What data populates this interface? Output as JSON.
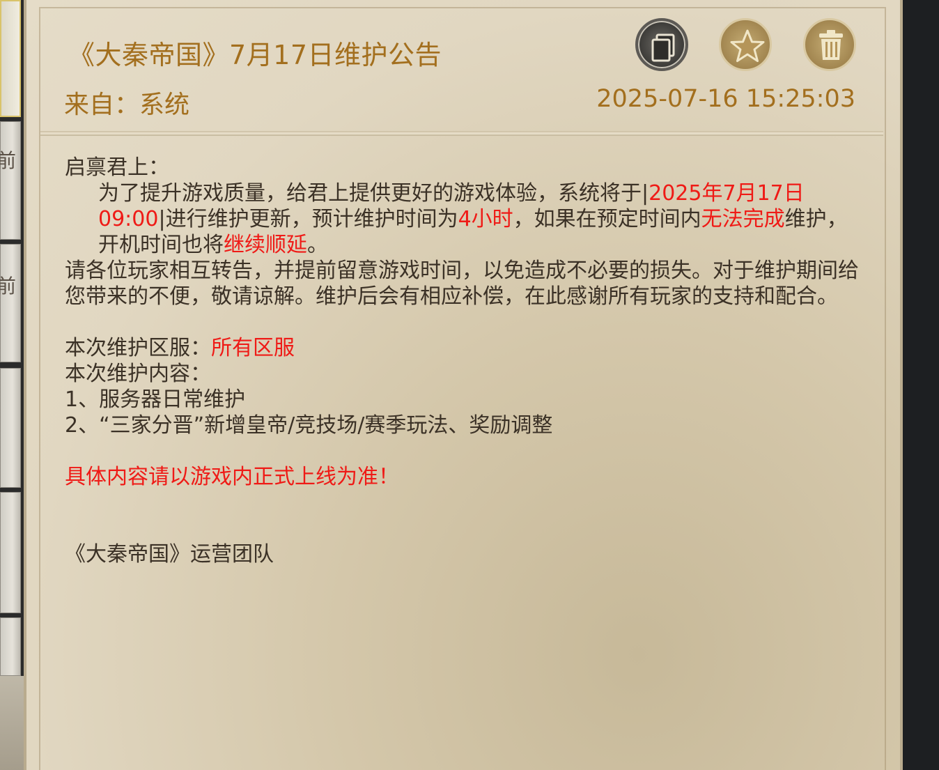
{
  "mail": {
    "title": "《大秦帝国》7月17日维护公告",
    "from": "来自：系统",
    "datetime": "2025-07-16 15:25:03",
    "greeting": "启禀君上：",
    "para1": [
      {
        "text": "为了提升游戏质量，给君上提供更好的游戏体验，系统将于|",
        "red": false
      },
      {
        "text": "2025年7月17日09:00",
        "red": true
      },
      {
        "text": "|进行维护更新，预计维护时间为",
        "red": false
      },
      {
        "text": "4小时",
        "red": true
      },
      {
        "text": "，如果在预定时间内",
        "red": false
      },
      {
        "text": "无法完成",
        "red": true
      },
      {
        "text": "维护，开机时间也将",
        "red": false
      },
      {
        "text": "继续顺延",
        "red": true
      },
      {
        "text": "。",
        "red": false
      }
    ],
    "para2": "请各位玩家相互转告，并提前留意游戏时间，以免造成不必要的损失。对于维护期间给您带来的不便，敬请谅解。维护后会有相应补偿，在此感谢所有玩家的支持和配合。",
    "zone_label": "本次维护区服：",
    "zone_value": "所有区服",
    "content_label": "本次维护内容：",
    "item1": "1、服务器日常维护",
    "item2": "2、“三家分晋”新增皇帝/竞技场/赛季玩法、奖励调整",
    "notice": "具体内容请以游戏内正式上线为准！",
    "signature": "《大秦帝国》运营团队"
  },
  "left_tabs": [
    {
      "glyph": "",
      "active": true
    },
    {
      "glyph": "前",
      "active": false
    },
    {
      "glyph": "前",
      "active": false
    },
    {
      "glyph": "",
      "active": false
    },
    {
      "glyph": "",
      "active": false
    },
    {
      "glyph": "",
      "active": false
    }
  ],
  "icons": {
    "copy": "copy-icon",
    "favorite": "star-icon",
    "delete": "trash-icon"
  },
  "colors": {
    "title": "#a36f1e",
    "highlight": "#ef1a16",
    "body": "#3b3126"
  }
}
